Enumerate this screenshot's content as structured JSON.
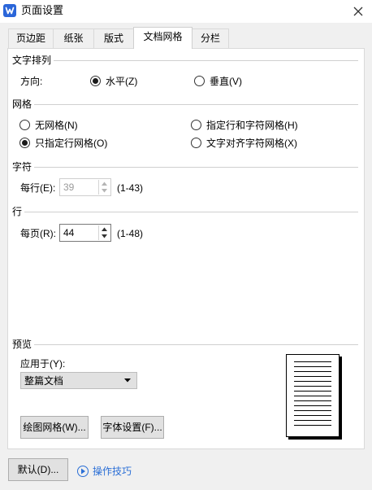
{
  "window": {
    "title": "页面设置"
  },
  "tabs": [
    {
      "label": "页边距"
    },
    {
      "label": "纸张"
    },
    {
      "label": "版式"
    },
    {
      "label": "文档网格"
    },
    {
      "label": "分栏"
    }
  ],
  "selected_tab": "文档网格",
  "text_direction": {
    "section_label": "文字排列",
    "direction_label": "方向:",
    "horizontal_label": "水平(Z)",
    "vertical_label": "垂直(V)",
    "selected": "水平(Z)"
  },
  "grid": {
    "section_label": "网格",
    "options": [
      {
        "label": "无网格(N)"
      },
      {
        "label": "指定行和字符网格(H)"
      },
      {
        "label": "只指定行网格(O)"
      },
      {
        "label": "文字对齐字符网格(X)"
      }
    ],
    "selected": "只指定行网格(O)"
  },
  "characters": {
    "section_label": "字符",
    "per_line_label": "每行(E):",
    "per_line_value": "39",
    "range": "(1-43)",
    "enabled": false
  },
  "lines": {
    "section_label": "行",
    "per_page_label": "每页(R):",
    "per_page_value": "44",
    "range": "(1-48)"
  },
  "preview": {
    "section_label": "预览",
    "apply_to_label": "应用于(Y):",
    "apply_to_value": "整篇文档"
  },
  "buttons": {
    "draw_grid": "绘图网格(W)...",
    "font_settings": "字体设置(F)...",
    "default": "默认(D)..."
  },
  "footer": {
    "tips_link": "操作技巧"
  },
  "colors": {
    "accent": "#2b6fd6",
    "app_icon": "#2b66d9"
  }
}
